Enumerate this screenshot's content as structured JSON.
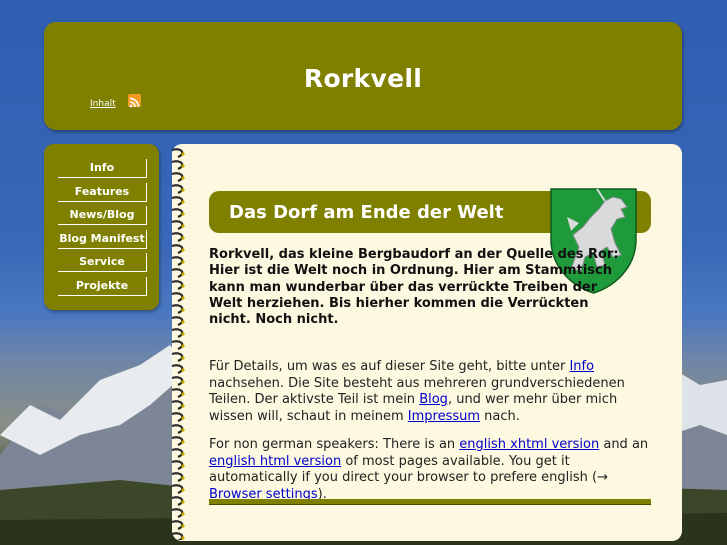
{
  "header": {
    "title": "Rorkvell",
    "nav_inhalt": "Inhalt",
    "rss_icon": "rss-feed-icon"
  },
  "sidebar": {
    "items": [
      {
        "label": "Info"
      },
      {
        "label": "Features"
      },
      {
        "label": "News/Blog"
      },
      {
        "label": "Blog Manifest"
      },
      {
        "label": "Service"
      },
      {
        "label": "Projekte"
      }
    ]
  },
  "main": {
    "heading": "Das Dorf am Ende der Welt",
    "crest_icon": "unicorn-crest-icon",
    "lead": "Rorkvell, das kleine Bergbaudorf an der Quelle des Ror: Hier ist die Welt noch in Ordnung. Hier am Stammtisch kann man wunderbar über das verrückte Treiben der Welt herziehen. Bis hierher kommen die Verrückten nicht. Noch nicht.",
    "p1": {
      "t1": "Für Details, um was es auf dieser Site geht, bitte unter ",
      "link_info": "Info",
      "t2": " nachsehen. Die Site besteht aus mehreren grundverschiedenen Teilen. Der aktivste Teil ist mein ",
      "link_blog": "Blog",
      "t3": ", und wer mehr über mich wissen will, schaut in meinem ",
      "link_impressum": "Impressum",
      "t4": " nach."
    },
    "p2": {
      "t1": "For non german speakers: There is an ",
      "link_xhtml": "english xhtml version",
      "t2": " and an ",
      "link_html": "english html version",
      "t3": " of most pages available. You get it automatically if you direct your browser to prefere english (→ ",
      "link_browser": "Browser settings",
      "t4": ")."
    }
  },
  "colors": {
    "olive": "#808000",
    "paper": "#fdf8e0",
    "crest_green": "#1f9a3a",
    "link": "#0000cc"
  }
}
